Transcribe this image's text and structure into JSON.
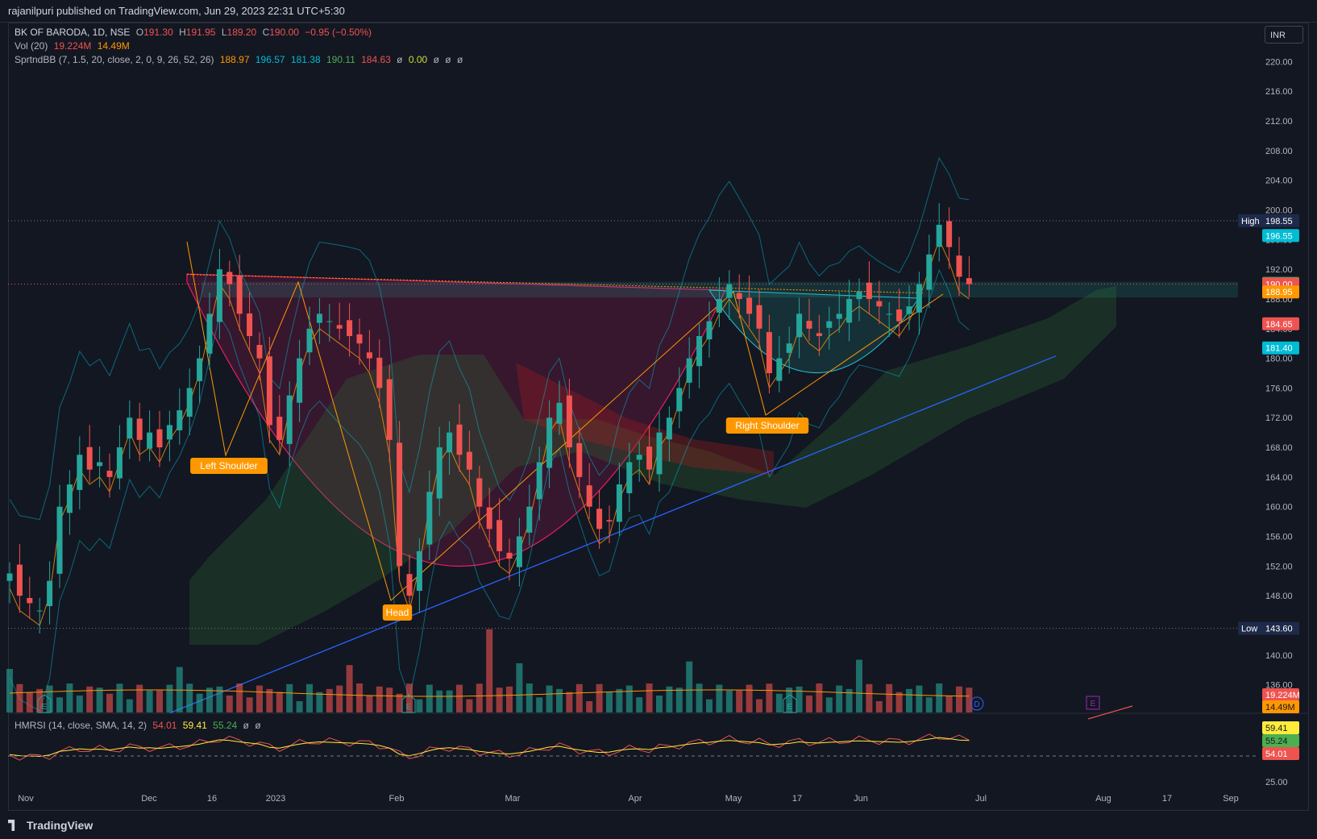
{
  "header": {
    "publisher_line": "rajanilpuri published on TradingView.com, Jun 29, 2023 22:31 UTC+5:30"
  },
  "legend": {
    "symbol": "BK OF BARODA, 1D, NSE",
    "open_label": "O",
    "open": "191.30",
    "high_label": "H",
    "high": "191.95",
    "low_label": "L",
    "low": "189.20",
    "close_label": "C",
    "close": "190.00",
    "change": "−0.95 (−0.50%)",
    "vol_label": "Vol (20)",
    "vol_value": "19.224M",
    "vol_ma": "14.49M",
    "ind_label": "SprtndBB (7, 1.5, 20, close, 2, 0, 9, 26, 52, 26)",
    "ind_values": [
      "188.97",
      "196.57",
      "181.38",
      "190.11",
      "184.63",
      "ø",
      "0.00",
      "ø",
      "ø",
      "ø"
    ],
    "rsi_label": "HMRSI (14, close, SMA, 14, 2)",
    "rsi_values": [
      "54.01",
      "59.41",
      "55.24",
      "ø",
      "ø"
    ]
  },
  "currency": "INR",
  "footer": {
    "brand": "TradingView"
  },
  "colors": {
    "up": "#26a69a",
    "down": "#ef5350",
    "orange": "#ff9800",
    "blue": "#2962ff",
    "cyan": "#00bcd4",
    "green": "#4caf50",
    "yellow": "#ffeb3b",
    "bg": "#131722"
  },
  "chart_data": {
    "type": "candlestick",
    "price_axis": {
      "min": 134,
      "max": 222,
      "ticks": [
        220,
        216,
        212,
        208,
        204,
        200,
        196,
        192,
        188,
        184,
        180,
        176,
        172,
        168,
        164,
        160,
        156,
        152,
        148,
        144,
        140,
        136
      ]
    },
    "x_axis": {
      "ticks": [
        "Nov",
        "Dec",
        "16",
        "2023",
        "Feb",
        "Mar",
        "Apr",
        "May",
        "17",
        "Jun",
        "Jul",
        "Aug",
        "17",
        "Sep"
      ]
    },
    "rsi_axis": {
      "ticks": [
        "25.00"
      ]
    },
    "price_labels": [
      {
        "text": "196.55",
        "price": 196.55,
        "color": "#00bcd4"
      },
      {
        "text": "190.10",
        "price": 190.1,
        "color": "#4caf50"
      },
      {
        "text": "190.00",
        "price": 190.0,
        "color": "#ef5350"
      },
      {
        "text": "188.95",
        "price": 188.95,
        "color": "#ff9800"
      },
      {
        "text": "184.65",
        "price": 184.65,
        "color": "#ef5350"
      },
      {
        "text": "181.40",
        "price": 181.4,
        "color": "#00bcd4"
      }
    ],
    "high_marker": {
      "label": "High",
      "value": "198.55"
    },
    "low_marker": {
      "label": "Low",
      "value": "143.60"
    },
    "volume_labels": [
      "19.224M",
      "14.49M"
    ],
    "rsi_labels": [
      "59.41",
      "55.24",
      "54.01"
    ],
    "annotations": [
      "Left Shoulder",
      "Head",
      "Right Shoulder"
    ],
    "event_marks": [
      "E",
      "E",
      "E",
      "D",
      "E"
    ],
    "close_path": [
      151,
      148,
      147,
      146,
      150,
      160,
      163,
      167,
      165,
      166,
      164,
      168,
      172,
      169,
      170,
      168,
      171,
      173,
      176,
      180,
      186,
      192,
      190,
      186,
      183,
      180,
      171,
      169,
      175,
      180,
      184,
      186,
      185,
      184,
      183,
      182,
      180,
      176,
      169,
      152,
      148,
      154,
      162,
      168,
      170,
      167,
      165,
      160,
      157,
      154,
      153,
      156,
      160,
      166,
      172,
      174,
      168,
      164,
      160,
      157,
      158,
      163,
      166,
      167,
      165,
      170,
      172,
      176,
      180,
      183,
      185,
      188,
      190,
      188,
      186,
      184,
      178,
      180,
      182,
      186,
      184,
      183,
      185,
      186,
      188,
      189,
      188,
      187,
      186,
      185,
      187,
      190,
      194,
      198,
      195,
      191,
      190
    ]
  }
}
